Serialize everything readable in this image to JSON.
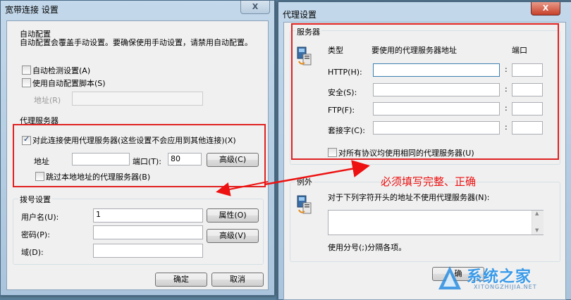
{
  "left_window": {
    "title": "宽带连接 设置",
    "close_glyph": "X",
    "auto_group": {
      "title": "自动配置",
      "description": "自动配置会覆盖手动设置。要确保使用手动设置，请禁用自动配置。",
      "auto_detect_label": "自动检测设置(A)",
      "use_script_label": "使用自动配置脚本(S)",
      "address_label": "地址(R)",
      "address_value": ""
    },
    "proxy_group": {
      "title": "代理服务器",
      "use_proxy_label": "对此连接使用代理服务器(这些设置不会应用到其他连接)(X)",
      "address_label": "地址",
      "address_value": "",
      "port_label": "端口(T):",
      "port_value": "80",
      "advanced_label": "高级(C)",
      "bypass_label": "跳过本地地址的代理服务器(B)"
    },
    "dial_group": {
      "title": "拨号设置",
      "username_label": "用户名(U):",
      "username_value": "1",
      "password_label": "密码(P):",
      "password_value": "",
      "domain_label": "域(D):",
      "domain_value": "",
      "properties_label": "属性(O)",
      "advanced_label": "高级(V)"
    },
    "ok_label": "确定",
    "cancel_label": "取消"
  },
  "right_window": {
    "title": "代理设置",
    "close_glyph": "X",
    "servers_group": {
      "title": "服务器",
      "col_type": "类型",
      "col_address": "要使用的代理服务器地址",
      "col_port": "端口",
      "rows": [
        {
          "label": "HTTP(H):",
          "address": "",
          "port": ""
        },
        {
          "label": "安全(S):",
          "address": "",
          "port": ""
        },
        {
          "label": "FTP(F):",
          "address": "",
          "port": ""
        },
        {
          "label": "套接字(C):",
          "address": "",
          "port": ""
        }
      ],
      "same_proxy_label": "对所有协议均使用相同的代理服务器(U)"
    },
    "exceptions_group": {
      "title": "例外",
      "description": "对于下列字符开头的地址不使用代理服务器(N):",
      "list_value": "",
      "hint": "使用分号(;)分隔各项。"
    },
    "ok_partial_label": "确"
  },
  "annotation": {
    "text": "必须填写完整、正确",
    "color": "#ee1111"
  },
  "watermark": {
    "text": "系统之家",
    "subtext": "XITONGZHIJIA.NET"
  }
}
